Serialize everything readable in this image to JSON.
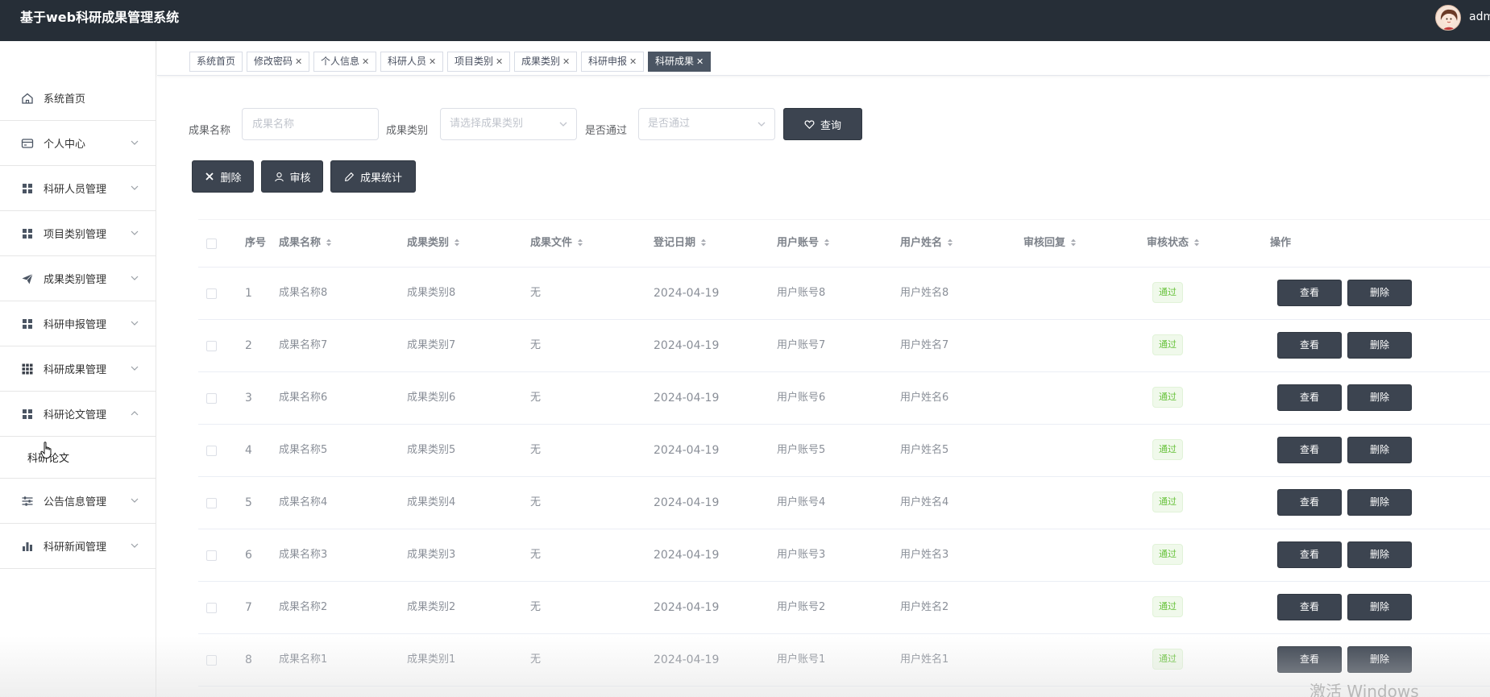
{
  "header": {
    "title": "基于web科研成果管理系统",
    "username": "adm"
  },
  "sidebar": {
    "items": [
      {
        "label": "系统首页",
        "icon": "home-icon"
      },
      {
        "label": "个人中心",
        "icon": "credit-card-icon"
      },
      {
        "label": "科研人员管理",
        "icon": "grid-icon"
      },
      {
        "label": "项目类别管理",
        "icon": "grid-icon"
      },
      {
        "label": "成果类别管理",
        "icon": "send-icon"
      },
      {
        "label": "科研申报管理",
        "icon": "grid-icon"
      },
      {
        "label": "科研成果管理",
        "icon": "apps-icon"
      },
      {
        "label": "科研论文管理",
        "icon": "grid-icon",
        "expanded": true
      },
      {
        "label": "公告信息管理",
        "icon": "sliders-icon"
      },
      {
        "label": "科研新闻管理",
        "icon": "bar-chart-icon"
      }
    ],
    "submenu": {
      "label": "科研论文"
    }
  },
  "tabs": [
    {
      "label": "系统首页",
      "closable": false
    },
    {
      "label": "修改密码",
      "closable": true
    },
    {
      "label": "个人信息",
      "closable": true
    },
    {
      "label": "科研人员",
      "closable": true
    },
    {
      "label": "项目类别",
      "closable": true
    },
    {
      "label": "成果类别",
      "closable": true
    },
    {
      "label": "科研申报",
      "closable": true
    },
    {
      "label": "科研成果",
      "closable": true,
      "active": true
    }
  ],
  "search": {
    "name_label": "成果名称",
    "name_placeholder": "成果名称",
    "type_label": "成果类别",
    "type_placeholder": "请选择成果类别",
    "passed_label": "是否通过",
    "passed_placeholder": "是否通过",
    "query_button": "查询"
  },
  "toolbar": {
    "delete_label": "删除",
    "review_label": "审核",
    "stats_label": "成果统计"
  },
  "table": {
    "columns": [
      "序号",
      "成果名称",
      "成果类别",
      "成果文件",
      "登记日期",
      "用户账号",
      "用户姓名",
      "审核回复",
      "审核状态",
      "操作"
    ],
    "view_label": "查看",
    "delete_label": "删除",
    "rows": [
      {
        "idx": "1",
        "name": "成果名称8",
        "type": "成果类别8",
        "file": "无",
        "date": "2024-04-19",
        "account": "用户账号8",
        "uname": "用户姓名8",
        "reply": "",
        "status": "通过"
      },
      {
        "idx": "2",
        "name": "成果名称7",
        "type": "成果类别7",
        "file": "无",
        "date": "2024-04-19",
        "account": "用户账号7",
        "uname": "用户姓名7",
        "reply": "",
        "status": "通过"
      },
      {
        "idx": "3",
        "name": "成果名称6",
        "type": "成果类别6",
        "file": "无",
        "date": "2024-04-19",
        "account": "用户账号6",
        "uname": "用户姓名6",
        "reply": "",
        "status": "通过"
      },
      {
        "idx": "4",
        "name": "成果名称5",
        "type": "成果类别5",
        "file": "无",
        "date": "2024-04-19",
        "account": "用户账号5",
        "uname": "用户姓名5",
        "reply": "",
        "status": "通过"
      },
      {
        "idx": "5",
        "name": "成果名称4",
        "type": "成果类别4",
        "file": "无",
        "date": "2024-04-19",
        "account": "用户账号4",
        "uname": "用户姓名4",
        "reply": "",
        "status": "通过"
      },
      {
        "idx": "6",
        "name": "成果名称3",
        "type": "成果类别3",
        "file": "无",
        "date": "2024-04-19",
        "account": "用户账号3",
        "uname": "用户姓名3",
        "reply": "",
        "status": "通过"
      },
      {
        "idx": "7",
        "name": "成果名称2",
        "type": "成果类别2",
        "file": "无",
        "date": "2024-04-19",
        "account": "用户账号2",
        "uname": "用户姓名2",
        "reply": "",
        "status": "通过"
      },
      {
        "idx": "8",
        "name": "成果名称1",
        "type": "成果类别1",
        "file": "无",
        "date": "2024-04-19",
        "account": "用户账号1",
        "uname": "用户姓名1",
        "reply": "",
        "status": "通过"
      }
    ]
  },
  "watermark": "激活 Windows",
  "colors": {
    "header_bg": "#262e37",
    "button_dark": "#3c4450",
    "status_green": "#67c23a"
  }
}
